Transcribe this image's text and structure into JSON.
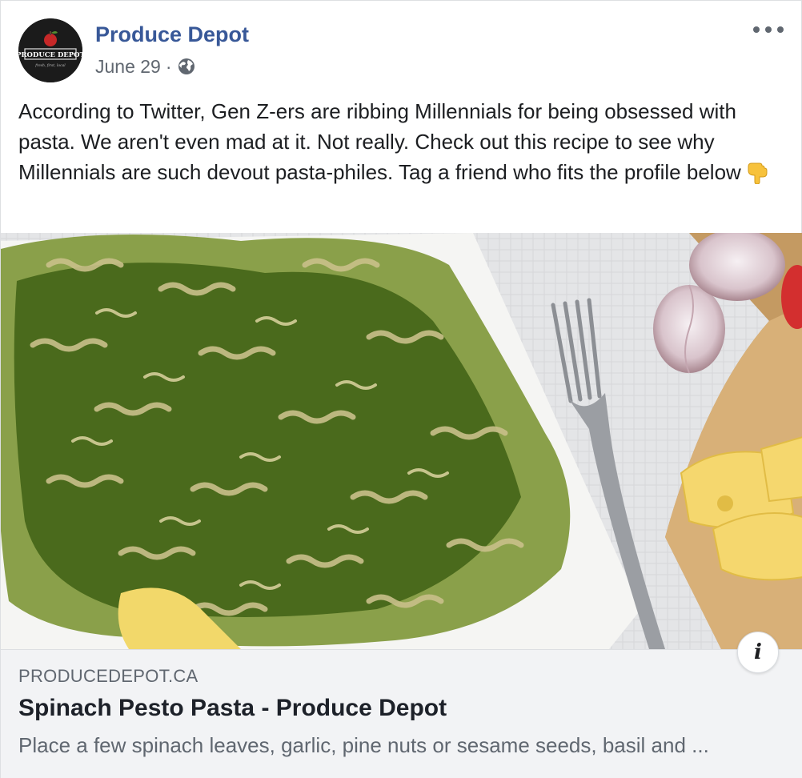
{
  "post": {
    "page_name": "Produce Depot",
    "date": "June 29",
    "separator": "·",
    "privacy_icon": "globe-icon",
    "more_icon": "more-options-icon",
    "avatar": {
      "logo_text": "PRODUCE DEPOT",
      "logo_tagline": "fresh, first, local",
      "logo_icon": "apple-icon"
    },
    "message": "According to Twitter, Gen Z-ers are ribbing Millennials for being obsessed with pasta. We aren't even mad at it. Not really. Check out this recipe to see why Millennials are such devout pasta-philes. Tag a friend who fits the profile below",
    "message_emoji": "pointing-down-hand-icon"
  },
  "link_preview": {
    "image_subject": "spinach pesto fusilli pasta on a white plate with fork, garlic and cheese",
    "domain": "PRODUCEDEPOT.CA",
    "title": "Spinach Pesto Pasta - Produce Depot",
    "description": "Place a few spinach leaves, garlic, pine nuts or sesame seeds, basil and ...",
    "info_icon": "info-icon",
    "info_label": "i"
  },
  "colors": {
    "page_name": "#385898",
    "meta_text": "#606770",
    "card_background": "#f2f3f5",
    "pasta_green": "#4a6a1c",
    "pasta_cream": "#c9c08a"
  }
}
